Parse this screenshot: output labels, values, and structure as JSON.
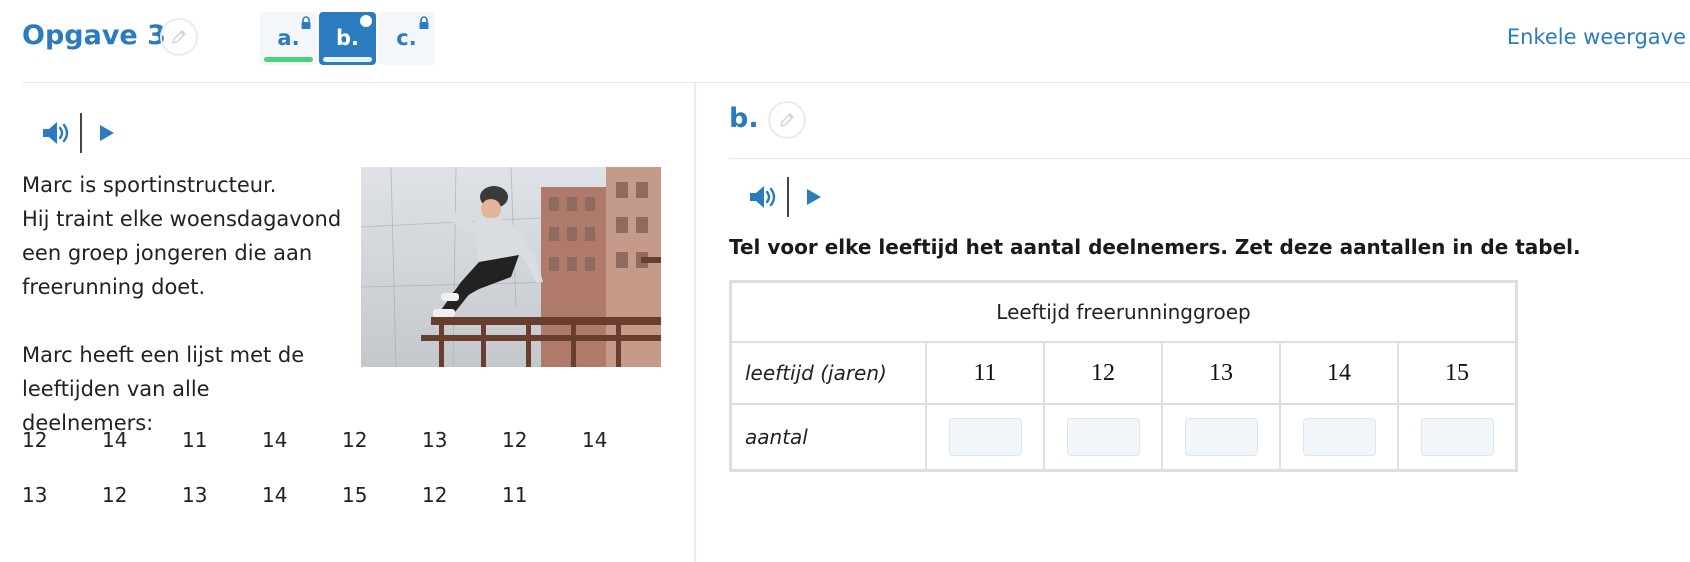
{
  "header": {
    "title": "Opgave 3",
    "view_toggle": "Enkele weergave",
    "tabs": [
      {
        "label": "a.",
        "state": "locked",
        "progress_color": "#4cd07a"
      },
      {
        "label": "b.",
        "state": "active",
        "progress_color": "#e9f3fb"
      },
      {
        "label": "c.",
        "state": "locked",
        "progress_color": ""
      }
    ]
  },
  "left": {
    "story": {
      "paragraph1": [
        "Marc is sportinstructeur.",
        "Hij traint elke woensdagavond",
        "een groep jongeren die aan",
        "freerunning doet."
      ],
      "paragraph2": [
        "Marc heeft een lijst met de",
        "leeftijden van alle deelnemers:"
      ]
    },
    "ages": [
      [
        "12",
        "14",
        "11",
        "14",
        "12",
        "13",
        "12",
        "14"
      ],
      [
        "13",
        "12",
        "13",
        "14",
        "15",
        "12",
        "11"
      ]
    ]
  },
  "right": {
    "question_label": "b.",
    "instruction": "Tel voor elke leeftijd het aantal deelnemers. Zet deze aantallen in de tabel.",
    "table": {
      "caption": "Leeftijd freerunninggroep",
      "row1_label": "leeftijd (jaren)",
      "row2_label": "aantal",
      "ages": [
        "11",
        "12",
        "13",
        "14",
        "15"
      ],
      "counts": [
        "",
        "",
        "",
        "",
        ""
      ]
    }
  },
  "colors": {
    "accent": "#2b7bbf",
    "tab_inactive_bg": "#f3f7fa",
    "progress_done": "#4cd07a"
  },
  "icons": [
    "pencil-icon",
    "lock-icon",
    "speaker-icon",
    "play-icon"
  ]
}
